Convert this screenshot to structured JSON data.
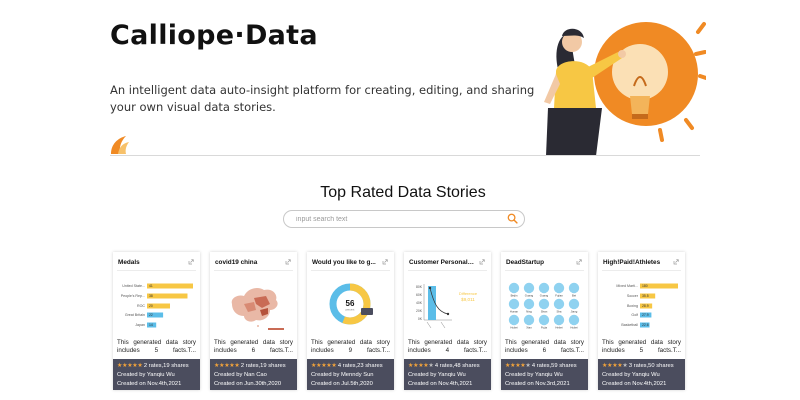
{
  "header": {
    "brand": "Calliope·Data",
    "tagline": "An intelligent data auto-insight platform for creating, editing, and sharing your own visual data stories."
  },
  "section": {
    "title": "Top Rated Data Stories"
  },
  "search": {
    "placeholder": "input search text",
    "value": ""
  },
  "colors": {
    "accent_orange": "#f08a24",
    "footer_bg": "#4b4d5e",
    "star": "#f2a33a",
    "bar_yellow": "#f7c744",
    "bar_blue": "#5bbde8"
  },
  "cards": [
    {
      "title": "Medals",
      "desc": "This generated data story includes 5 facts.T...",
      "rating": "2 rates,19 shares",
      "stars": 5,
      "creator": "Created by Yanqiu Wu",
      "created": "Created on Nov.4th,2021",
      "thumb": {
        "labels": [
          "United State...",
          "People's Rep...",
          "ROC",
          "Great Britain",
          "Japan"
        ],
        "values": [
          "41",
          "38",
          "20",
          "22",
          "14"
        ],
        "fractions": [
          1.0,
          0.88,
          0.5,
          0.35,
          0.2
        ]
      }
    },
    {
      "title": "covid19 china",
      "desc": "This generated data story includes 6 facts.T...",
      "rating": "2 rates,19 shares",
      "stars": 5,
      "creator": "Created by Nan Cao",
      "created": "Created on Jun.30th,2020",
      "thumb": {
        "icon": "china-map-icon"
      }
    },
    {
      "title": "Would you like to g...",
      "desc": "This generated data story includes 9 facts.T...",
      "rating": "4 rates,23 shares",
      "stars": 5,
      "creator": "Created by Menndy Sun",
      "created": "Created on Jul.5th,2020",
      "thumb": {
        "center": "56",
        "center_sub": "percent",
        "fraction": 0.56
      }
    },
    {
      "title": "Customer Personality",
      "desc": "This generated data story includes 4 facts.T...",
      "rating": "4 rates,48 shares",
      "stars": 4,
      "creator": "Created by Yanqiu Wu",
      "created": "Created on Nov.4th,2021",
      "thumb": {
        "yticks": [
          "80K",
          "60K",
          "40K",
          "20K",
          "0K"
        ],
        "diff_label": "Difference",
        "diff_value": "$9,011"
      }
    },
    {
      "title": "DeadStartup",
      "desc": "This generated data story includes 6 facts.T...",
      "rating": "4 rates,59 shares",
      "stars": 4,
      "creator": "Created by Yanqiu Wu",
      "created": "Created on Nov.3rd,2021",
      "thumb": {
        "labels": [
          "Beijin",
          "Guang",
          "Guang",
          "Fujian",
          "Bei",
          "Hunan",
          "Ning",
          "Shan",
          "Sha",
          "Jiang",
          "Hubei",
          "Xian",
          "Fujia",
          "Hebei",
          "Hubei"
        ]
      }
    },
    {
      "title": "High!Paid!Athletes",
      "desc": "This generated data story includes 5 facts.T...",
      "rating": "3 rates,50 shares",
      "stars": 4,
      "creator": "Created by Yanqiu Wu",
      "created": "Created on Nov.4th,2021",
      "thumb": {
        "labels": [
          "Mixed Marti...",
          "Soccer",
          "Boxing",
          "Golf",
          "Basketball"
        ],
        "values": [
          "180",
          "35.5",
          "28.9",
          "27.9",
          "22.6"
        ],
        "fractions": [
          1.0,
          0.4,
          0.32,
          0.3,
          0.25
        ]
      }
    }
  ]
}
